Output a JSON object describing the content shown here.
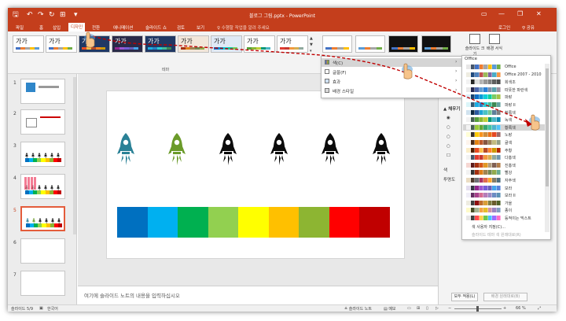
{
  "window": {
    "title": "블로그 그림.pptx - PowerPoint",
    "user": "로그인",
    "share": "공유"
  },
  "menu": {
    "items": [
      "파일",
      "홈",
      "삽입",
      "디자인",
      "전환",
      "애니메이션",
      "슬라이드 쇼",
      "검토",
      "보기"
    ],
    "tellme": "수행할 작업을 알려 주세요"
  },
  "ribbon": {
    "theme_thumb_text": "가가",
    "themes_label": "테마",
    "slide_size_label": "슬라이드 크기",
    "format_bg_label": "배경 서식"
  },
  "context_menu": {
    "items": [
      {
        "label": "색(C)",
        "has_submenu": true
      },
      {
        "label": "글꼴(F)",
        "has_submenu": true
      },
      {
        "label": "효과",
        "has_submenu": true
      },
      {
        "label": "배경 스타일",
        "has_submenu": true
      }
    ]
  },
  "palette": {
    "header": "Office",
    "rows": [
      {
        "name": "Office",
        "colors": [
          "#ffffff",
          "#000000",
          "#e7e6e6",
          "#44546a",
          "#4472c4",
          "#ed7d31",
          "#a5a5a5",
          "#ffc000",
          "#5b9bd5",
          "#70ad47"
        ]
      },
      {
        "name": "Office 2007 - 2010",
        "colors": [
          "#ffffff",
          "#000000",
          "#eeece1",
          "#1f497d",
          "#4f81bd",
          "#c0504d",
          "#9bbb59",
          "#8064a2",
          "#4bacc6",
          "#f79646"
        ]
      },
      {
        "name": "회색조",
        "colors": [
          "#ffffff",
          "#000000",
          "#f2f2f2",
          "#262626",
          "#dddddd",
          "#b2b2b2",
          "#969696",
          "#808080",
          "#5f5f5f",
          "#4d4d4d"
        ]
      },
      {
        "name": "따뜻한 파란색",
        "colors": [
          "#ffffff",
          "#000000",
          "#e8e8e8",
          "#242852",
          "#4a66ac",
          "#629dd1",
          "#297fd5",
          "#7f8fa9",
          "#5aa2ae",
          "#9d90a0"
        ]
      },
      {
        "name": "파랑",
        "colors": [
          "#ffffff",
          "#000000",
          "#dbeff9",
          "#17406d",
          "#0f6fc6",
          "#009dd9",
          "#0bd0d9",
          "#10cf9b",
          "#7cca62",
          "#a5c249"
        ]
      },
      {
        "name": "파랑 II",
        "colors": [
          "#ffffff",
          "#000000",
          "#dbf5f9",
          "#335b74",
          "#1cade4",
          "#2683c6",
          "#27ced7",
          "#42ba97",
          "#3e8853",
          "#62a39f"
        ]
      },
      {
        "name": "청록색",
        "colors": [
          "#ffffff",
          "#000000",
          "#d1e3ef",
          "#0e2841",
          "#2c5aa0",
          "#1ea5d7",
          "#49c3c3",
          "#76c893",
          "#5f7f99",
          "#7f7f7f"
        ]
      },
      {
        "name": "녹색",
        "colors": [
          "#ffffff",
          "#000000",
          "#f2f2f2",
          "#455f51",
          "#549e39",
          "#8ab833",
          "#c0cf3a",
          "#029676",
          "#4ab5c4",
          "#0989b1"
        ]
      },
      {
        "name": "황록색",
        "colors": [
          "#ffffff",
          "#000000",
          "#f2f2f2",
          "#455f51",
          "#99cb38",
          "#63a537",
          "#37a76f",
          "#44c1a3",
          "#4eb3cf",
          "#51c3f9"
        ]
      },
      {
        "name": "노랑",
        "colors": [
          "#ffffff",
          "#000000",
          "#fffed6",
          "#39302a",
          "#ffca08",
          "#f8931d",
          "#ce8d3e",
          "#ec7016",
          "#e64823",
          "#9c6a6a"
        ]
      },
      {
        "name": "귤색",
        "colors": [
          "#ffffff",
          "#000000",
          "#fef4ec",
          "#4a2b16",
          "#e48312",
          "#bd582c",
          "#865640",
          "#9b8357",
          "#c2bc80",
          "#94a088"
        ]
      },
      {
        "name": "주황",
        "colors": [
          "#ffffff",
          "#000000",
          "#fbeec9",
          "#4d1d00",
          "#e84c22",
          "#ffbd47",
          "#b64926",
          "#ff8427",
          "#cc9900",
          "#b22600"
        ]
      },
      {
        "name": "다홍색",
        "colors": [
          "#ffffff",
          "#000000",
          "#f2f2f2",
          "#44546a",
          "#e03c31",
          "#c7372f",
          "#f2983d",
          "#d6ae51",
          "#90a99e",
          "#6f97b1"
        ]
      },
      {
        "name": "진홍색",
        "colors": [
          "#ffffff",
          "#000000",
          "#f6d7d2",
          "#5e1c1a",
          "#a5300f",
          "#d55816",
          "#e19825",
          "#b19c7d",
          "#7f5f52",
          "#b27d49"
        ]
      },
      {
        "name": "빨강",
        "colors": [
          "#ffffff",
          "#000000",
          "#f2f2f2",
          "#323232",
          "#a5300f",
          "#de7e18",
          "#9f8351",
          "#728653",
          "#92aa4c",
          "#6aac91"
        ]
      },
      {
        "name": "자주색",
        "colors": [
          "#ffffff",
          "#000000",
          "#ebddc3",
          "#4e3b30",
          "#6f6f74",
          "#ab3264",
          "#e06b4d",
          "#ffa72c",
          "#827c69",
          "#4e6e7f"
        ]
      },
      {
        "name": "보라",
        "colors": [
          "#ffffff",
          "#000000",
          "#e3ddee",
          "#373545",
          "#92278f",
          "#9b57d3",
          "#755dd9",
          "#665eb8",
          "#45a5ed",
          "#5982db"
        ]
      },
      {
        "name": "보라 II",
        "colors": [
          "#ffffff",
          "#000000",
          "#f0eef7",
          "#632e62",
          "#a8418b",
          "#d56b92",
          "#b67cb8",
          "#9a8bc5",
          "#6c8cc3",
          "#5d92b6"
        ]
      },
      {
        "name": "가을",
        "colors": [
          "#ffffff",
          "#000000",
          "#eeece1",
          "#3f3f3f",
          "#8f0f0f",
          "#be6c2b",
          "#d99e37",
          "#7f7f42",
          "#6a5d2d",
          "#4f6228"
        ]
      },
      {
        "name": "종이",
        "colors": [
          "#ffffff",
          "#000000",
          "#fefac9",
          "#444d26",
          "#a5b592",
          "#f3a447",
          "#e7bc29",
          "#d092a7",
          "#9c85c0",
          "#809ec2"
        ]
      },
      {
        "name": "등적이는 믹스트",
        "colors": [
          "#ffffff",
          "#000000",
          "#e7e6e6",
          "#3f3f3f",
          "#ff4d4d",
          "#ffd14d",
          "#6dc84d",
          "#4dc0ff",
          "#9d6dff",
          "#ff6dc5"
        ]
      }
    ],
    "footer_1": "색 사용자 지정(C)...",
    "footer_2": "슬라이드 테마 색 원래대로(R)"
  },
  "slides": {
    "numbers": [
      "1",
      "2",
      "3",
      "4",
      "5",
      "6",
      "7"
    ]
  },
  "notes": {
    "placeholder": "여기에 슬라이드 노트의 내용을 입력하십시오"
  },
  "pane": {
    "header": "배경 서식",
    "fill_label": "채우기",
    "color_label": "색",
    "transparency_label": "투명도",
    "apply_all": "모두 적용(L)",
    "reset_bg": "배경 원래대로(B)"
  },
  "status": {
    "slide_count": "슬라이드 5/9",
    "language": "한국어",
    "notes_btn": "슬라이드 노트",
    "comments_btn": "메모",
    "zoom": "66 %"
  },
  "slide_content": {
    "rocket_colors": [
      "#2a8196",
      "#6b9b2a",
      "#0c0c0c",
      "#0c0c0c",
      "#0c0c0c",
      "#0c0c0c"
    ],
    "bar_colors": [
      "#0070c0",
      "#00b0f0",
      "#00b050",
      "#92d050",
      "#ffff00",
      "#ffc000",
      "#8db532",
      "#ff0000",
      "#c00000"
    ]
  },
  "colors": {
    "accent": "#c43e1c",
    "selection": "#e45c3b",
    "arrow": "#c00000"
  }
}
